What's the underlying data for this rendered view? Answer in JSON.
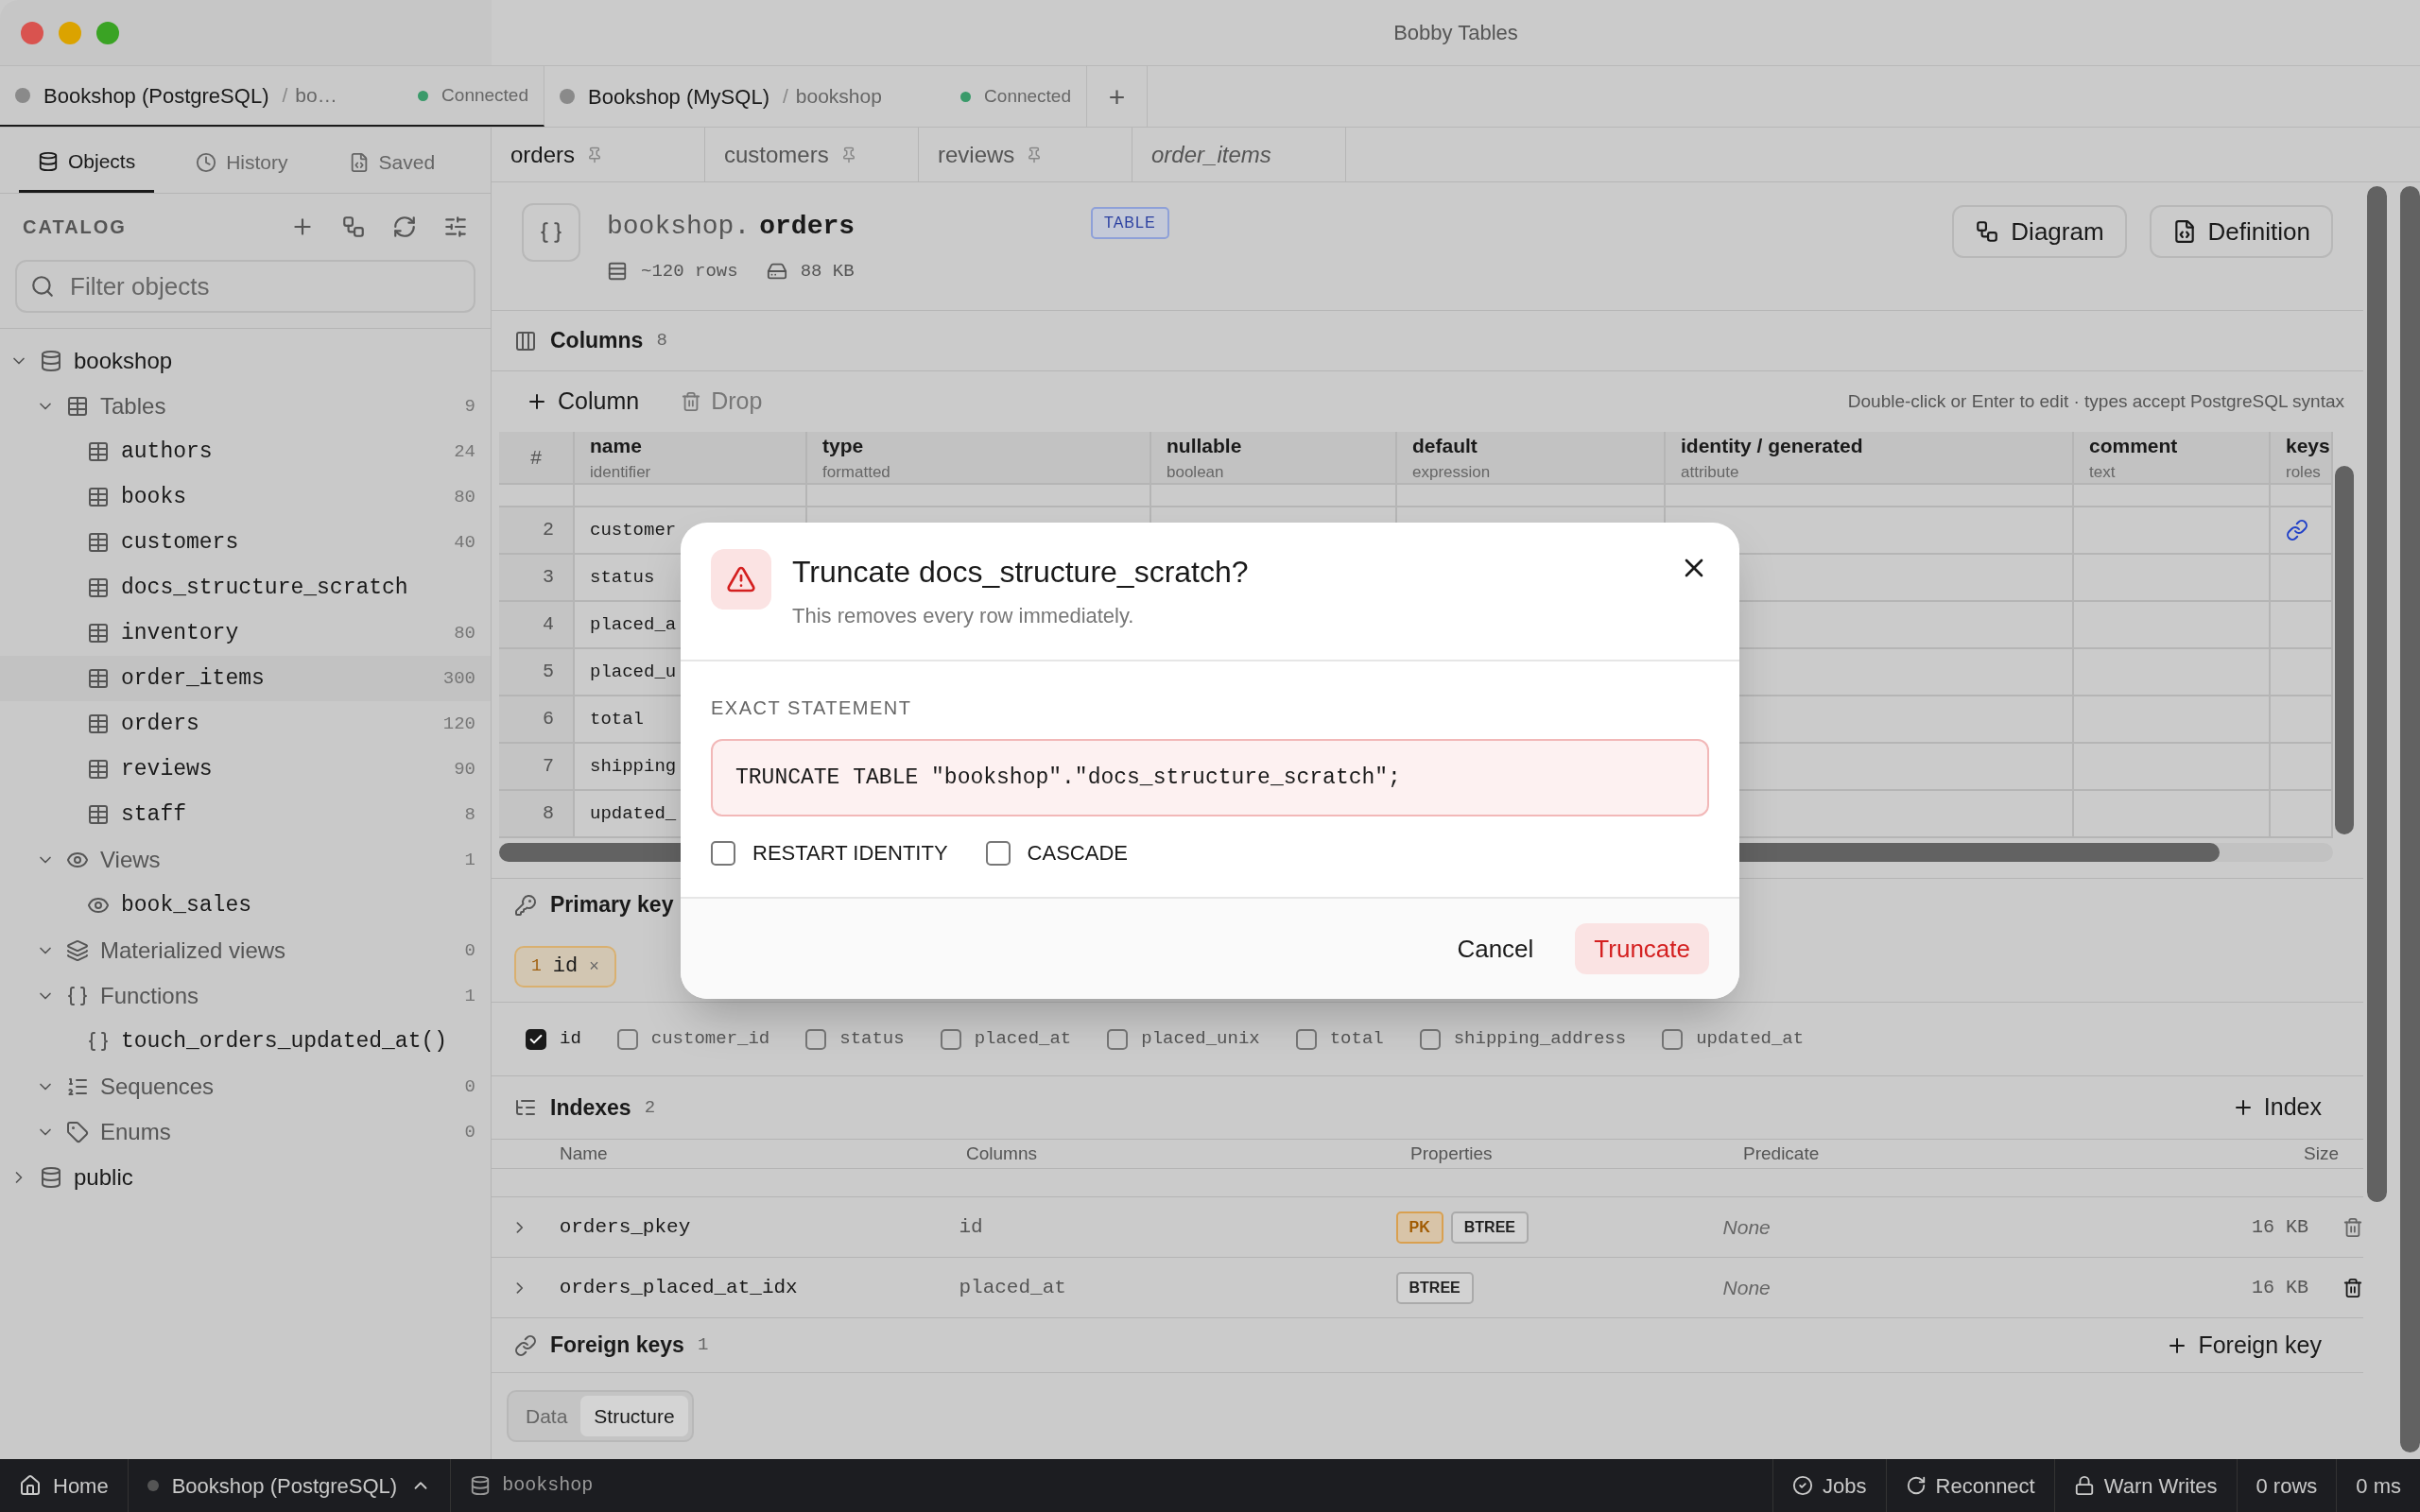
{
  "window": {
    "title": "Bobby Tables"
  },
  "connection_tabs": [
    {
      "name": "Bookshop (PostgreSQL)",
      "separator": "/",
      "database": "bo…",
      "status": "Connected",
      "selected": true
    },
    {
      "name": "Bookshop (MySQL)",
      "separator": "/",
      "database": "bookshop",
      "status": "Connected",
      "selected": false
    }
  ],
  "new_tab": "+",
  "sidebar": {
    "tabs": [
      {
        "label": "Objects",
        "kind": "objects",
        "selected": true
      },
      {
        "label": "History",
        "kind": "history",
        "selected": false
      },
      {
        "label": "Saved",
        "kind": "saved",
        "selected": false
      }
    ],
    "catalog_label": "CATALOG",
    "filter": {
      "placeholder": "Filter objects"
    },
    "tree": [
      {
        "label": "bookshop",
        "kind": "database",
        "expanded": true,
        "children": [
          {
            "label": "Tables",
            "kind": "tables",
            "count": "9",
            "expanded": true,
            "children": [
              {
                "label": "authors",
                "kind": "table",
                "count": "24",
                "selected": false
              },
              {
                "label": "books",
                "kind": "table",
                "count": "80",
                "selected": false
              },
              {
                "label": "customers",
                "kind": "table",
                "count": "40",
                "selected": false
              },
              {
                "label": "docs_structure_scratch",
                "kind": "table",
                "selected": false
              },
              {
                "label": "inventory",
                "kind": "table",
                "count": "80",
                "selected": false
              },
              {
                "label": "order_items",
                "kind": "table",
                "count": "300",
                "selected": true
              },
              {
                "label": "orders",
                "kind": "table",
                "count": "120",
                "selected": false
              },
              {
                "label": "reviews",
                "kind": "table",
                "count": "90",
                "selected": false
              },
              {
                "label": "staff",
                "kind": "table",
                "count": "8",
                "selected": false
              }
            ]
          },
          {
            "label": "Views",
            "kind": "views",
            "count": "1",
            "expanded": true,
            "children": [
              {
                "label": "book_sales",
                "kind": "view",
                "selected": false
              }
            ]
          },
          {
            "label": "Materialized views",
            "kind": "materialized",
            "count": "0",
            "expanded": true
          },
          {
            "label": "Functions",
            "kind": "functions",
            "count": "1",
            "expanded": true,
            "children": [
              {
                "label": "touch_orders_updated_at()",
                "kind": "function",
                "selected": false
              }
            ]
          },
          {
            "label": "Sequences",
            "kind": "sequences",
            "count": "0",
            "expanded": true
          },
          {
            "label": "Enums",
            "kind": "enums",
            "count": "0",
            "expanded": true
          }
        ]
      },
      {
        "label": "public",
        "kind": "database",
        "expanded": false
      }
    ]
  },
  "object_tabs": [
    {
      "label": "orders",
      "pinned": true,
      "preview": false,
      "selected": true
    },
    {
      "label": "customers",
      "pinned": true,
      "preview": false,
      "selected": false
    },
    {
      "label": "reviews",
      "pinned": true,
      "preview": false,
      "selected": false
    },
    {
      "label": "order_items",
      "pinned": false,
      "preview": true,
      "selected": false
    }
  ],
  "header": {
    "schema": "bookshop.",
    "name": "orders",
    "badge": "TABLE",
    "rows": "~120 rows",
    "size": "88 KB",
    "buttons": [
      {
        "label": "Diagram",
        "kind": "diagram"
      },
      {
        "label": "Definition",
        "kind": "definition"
      }
    ]
  },
  "columns_section": {
    "title": "Columns",
    "count": "8",
    "actions": [
      {
        "label": "Column",
        "kind": "add"
      },
      {
        "label": "Drop",
        "kind": "drop"
      }
    ],
    "hint": "Double-click or Enter to edit · types accept PostgreSQL syntax",
    "columns": [
      {
        "name": "#"
      },
      {
        "name": "name",
        "sub": "identifier"
      },
      {
        "name": "type",
        "sub": "formatted"
      },
      {
        "name": "nullable",
        "sub": "boolean"
      },
      {
        "name": "default",
        "sub": "expression"
      },
      {
        "name": "identity / generated",
        "sub": "attribute"
      },
      {
        "name": "comment",
        "sub": "text"
      },
      {
        "name": "keys",
        "sub": "roles"
      }
    ],
    "rows": [
      {
        "number": "2",
        "name": "customer",
        "kind": "foreign"
      },
      {
        "number": "3",
        "name": "status",
        "kind": "plain"
      },
      {
        "number": "4",
        "name": "placed_a",
        "kind": "plain"
      },
      {
        "number": "5",
        "name": "placed_u",
        "kind": "plain"
      },
      {
        "number": "6",
        "name": "total",
        "kind": "plain"
      },
      {
        "number": "7",
        "name": "shipping",
        "kind": "plain"
      },
      {
        "number": "8",
        "name": "updated_",
        "kind": "plain"
      }
    ]
  },
  "primary_key": {
    "title": "Primary key",
    "chips": [
      {
        "order": "1",
        "name": "id",
        "remove": "×"
      }
    ],
    "columns": [
      {
        "label": "id",
        "checked": true
      },
      {
        "label": "customer_id",
        "checked": false
      },
      {
        "label": "status",
        "checked": false
      },
      {
        "label": "placed_at",
        "checked": false
      },
      {
        "label": "placed_unix",
        "checked": false
      },
      {
        "label": "total",
        "checked": false
      },
      {
        "label": "shipping_address",
        "checked": false
      },
      {
        "label": "updated_at",
        "checked": false
      }
    ]
  },
  "indexes": {
    "title": "Indexes",
    "count": "2",
    "add": "Index",
    "columns": [
      "Name",
      "Columns",
      "Properties",
      "Predicate",
      "Size"
    ],
    "rows": [
      {
        "name": "orders_pkey",
        "columns": "id",
        "properties": [
          {
            "label": "PK",
            "kind": "primary"
          },
          {
            "label": "BTREE",
            "kind": "method"
          }
        ],
        "predicate": "None",
        "size": "16 KB"
      },
      {
        "name": "orders_placed_at_idx",
        "columns": "placed_at",
        "properties": [
          {
            "label": "BTREE",
            "kind": "method"
          }
        ],
        "predicate": "None",
        "size": "16 KB"
      }
    ]
  },
  "foreign_keys": {
    "title": "Foreign keys",
    "count": "1",
    "add": "Foreign key"
  },
  "view_switch": [
    {
      "label": "Data",
      "selected": false
    },
    {
      "label": "Structure",
      "selected": true
    }
  ],
  "status_bar": {
    "home": "Home",
    "connection": "Bookshop (PostgreSQL)",
    "database": "bookshop",
    "items": [
      {
        "label": "Jobs",
        "kind": "jobs"
      },
      {
        "label": "Reconnect",
        "kind": "reconnect"
      },
      {
        "label": "Warn Writes",
        "kind": "lock"
      },
      {
        "label": "0 rows",
        "kind": "text"
      },
      {
        "label": "0 ms",
        "kind": "text"
      }
    ]
  },
  "dialog": {
    "title": "Truncate docs_structure_scratch?",
    "subtitle": "This removes every row immediately.",
    "statement_label": "EXACT STATEMENT",
    "statement": "TRUNCATE TABLE \"bookshop\".\"docs_structure_scratch\";",
    "options": [
      {
        "label": "RESTART IDENTITY",
        "checked": false
      },
      {
        "label": "CASCADE",
        "checked": false
      }
    ],
    "cancel": "Cancel",
    "confirm": "Truncate"
  }
}
